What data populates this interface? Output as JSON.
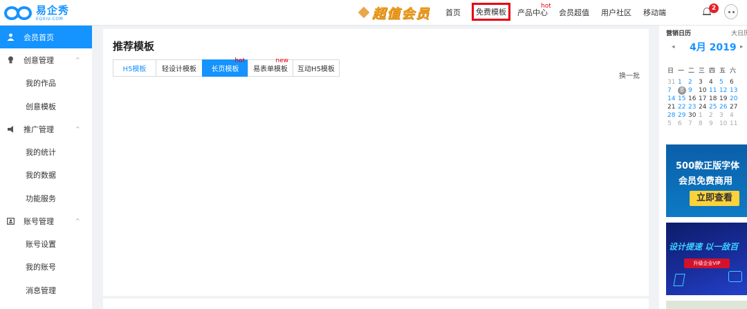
{
  "brand": {
    "name_cn": "易企秀",
    "name_en": "EQXIU.COM"
  },
  "promo": {
    "text": "超值会员"
  },
  "nav": [
    {
      "label": "首页"
    },
    {
      "label": "免费模板",
      "selected": true
    },
    {
      "label": "产品中心",
      "sup": "hot"
    },
    {
      "label": "会员超值"
    },
    {
      "label": "用户社区"
    },
    {
      "label": "移动端"
    }
  ],
  "notifications": {
    "count": "2"
  },
  "sidebar": {
    "items": [
      {
        "label": "会员首页",
        "icon": "user-icon",
        "active": true
      },
      {
        "label": "创意管理",
        "icon": "bulb-icon",
        "expanded": true
      },
      {
        "label": "我的作品",
        "child": true
      },
      {
        "label": "创意模板",
        "child": true
      },
      {
        "label": "推广管理",
        "icon": "megaphone-icon",
        "expanded": true
      },
      {
        "label": "我的统计",
        "child": true
      },
      {
        "label": "我的数据",
        "child": true
      },
      {
        "label": "功能服务",
        "child": true
      },
      {
        "label": "账号管理",
        "icon": "id-card-icon",
        "expanded": true
      },
      {
        "label": "账号设置",
        "child": true
      },
      {
        "label": "我的账号",
        "child": true
      },
      {
        "label": "消息管理",
        "child": true
      }
    ]
  },
  "main": {
    "title": "推荐模板",
    "tabs": [
      {
        "label": "H5模板"
      },
      {
        "label": "轻设计模板"
      },
      {
        "label": "长页模板",
        "sup": "hot",
        "active": true
      },
      {
        "label": "易表单模板",
        "sup": "new"
      },
      {
        "label": "互动H5模板"
      }
    ],
    "refresh_label": "换一批"
  },
  "calendar": {
    "title": "营销日历",
    "big_events": "大日历",
    "month": "4月 2019",
    "weekdays": [
      "日",
      "一",
      "二",
      "三",
      "四",
      "五",
      "六"
    ],
    "weeks": [
      [
        "31",
        "1",
        "2",
        "3",
        "4",
        "5",
        "6"
      ],
      [
        "7",
        "8",
        "9",
        "10",
        "11",
        "12",
        "13"
      ],
      [
        "14",
        "15",
        "16",
        "17",
        "18",
        "19",
        "20"
      ],
      [
        "21",
        "22",
        "23",
        "24",
        "25",
        "26",
        "27"
      ],
      [
        "28",
        "29",
        "30",
        "1",
        "2",
        "3",
        "4"
      ],
      [
        "5",
        "6",
        "7",
        "8",
        "9",
        "10",
        "11"
      ]
    ],
    "today": "8"
  },
  "banners": {
    "font": {
      "line1": "500款正版字体",
      "line2": "会员免费商用",
      "button": "立即查看"
    },
    "design": {
      "headline": "设计提速 以一敌百",
      "button": "升级企业VIP"
    }
  },
  "colors": {
    "primary": "#1593ff",
    "hot": "#e60012",
    "promo": "#f0a020"
  }
}
